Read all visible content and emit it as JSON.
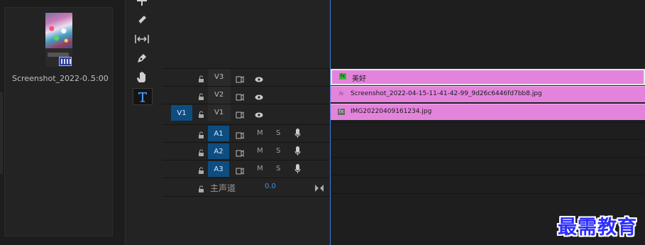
{
  "project": {
    "item_name": "Screenshot_2022-0...",
    "item_duration": "5:00"
  },
  "tools": [
    "track-select-icon",
    "ripple-edit-icon",
    "slip-icon",
    "pen-icon",
    "hand-icon",
    "type-icon"
  ],
  "tracks": {
    "video": [
      {
        "id": "V3",
        "source": ""
      },
      {
        "id": "V2",
        "source": ""
      },
      {
        "id": "V1",
        "source": "V1"
      }
    ],
    "audio": [
      {
        "id": "A1",
        "m": "M",
        "s": "S"
      },
      {
        "id": "A2",
        "m": "M",
        "s": "S"
      },
      {
        "id": "A3",
        "m": "M",
        "s": "S"
      }
    ],
    "master": {
      "label": "主声道",
      "value": "0.0"
    }
  },
  "clips": [
    {
      "name": "美好",
      "fx": "fx"
    },
    {
      "name": "Screenshot_2022-04-15-11-41-42-99_9d26c6446fd7bb8.jpg",
      "fx": "fx"
    },
    {
      "name": "IMG20220409161234.jpg",
      "fx": "fx"
    }
  ],
  "colors": {
    "clip": "#e383dc",
    "target": "#0e4d80",
    "playhead": "#3c7fd6"
  },
  "watermark": "最需教育"
}
